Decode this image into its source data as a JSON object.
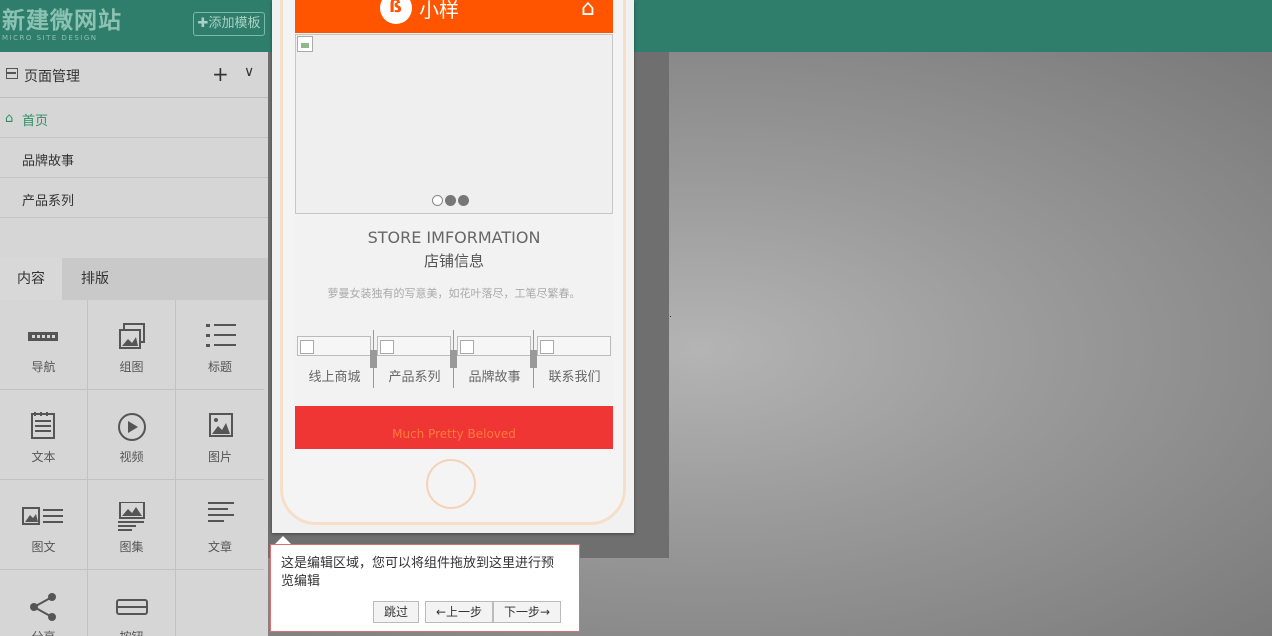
{
  "brand": {
    "name": "新建微网站",
    "tagline": "MICRO SITE DESIGN"
  },
  "toolbar": {
    "add_template": "✚添加模板"
  },
  "pages": {
    "title": "页面管理",
    "add_icon": "+",
    "collapse_icon": "∨",
    "items": [
      {
        "label": "首页",
        "icon": "⌂"
      },
      {
        "label": "品牌故事"
      },
      {
        "label": "产品系列"
      }
    ]
  },
  "tabs": [
    {
      "label": "内容"
    },
    {
      "label": "排版"
    }
  ],
  "components": [
    {
      "label": "导航",
      "icon": "nav-icon"
    },
    {
      "label": "组图",
      "icon": "gallery-icon"
    },
    {
      "label": "标题",
      "icon": "list-icon"
    },
    {
      "label": "文本",
      "icon": "text-icon"
    },
    {
      "label": "视频",
      "icon": "play-icon"
    },
    {
      "label": "图片",
      "icon": "image-icon"
    },
    {
      "label": "图文",
      "icon": "image-text-icon"
    },
    {
      "label": "图集",
      "icon": "album-icon"
    },
    {
      "label": "文章",
      "icon": "article-icon"
    },
    {
      "label": "分享",
      "icon": "share-icon"
    },
    {
      "label": "按钮",
      "icon": "button-icon"
    }
  ],
  "phone": {
    "app_title": "小样",
    "home_icon": "⌂",
    "store_title": "STORE IMFORMATION",
    "store_subtitle": "店铺信息",
    "store_desc": "萝曼女装独有的写意美，如花叶落尽，工笔尽繁春。",
    "nav": [
      {
        "label": "线上商城"
      },
      {
        "label": "产品系列"
      },
      {
        "label": "品牌故事"
      },
      {
        "label": "联系我们"
      }
    ],
    "footer_text": "Much Pretty Beloved"
  },
  "tip": {
    "text": "这是编辑区域，您可以将组件拖放到这里进行预览编辑",
    "skip": "跳过",
    "prev": "←上一步",
    "next": "下一步→"
  },
  "colors": {
    "header": "#2f7d6b",
    "accent_orange": "#ff5400",
    "accent_red": "#f03535",
    "home_green": "#2f8f64"
  }
}
